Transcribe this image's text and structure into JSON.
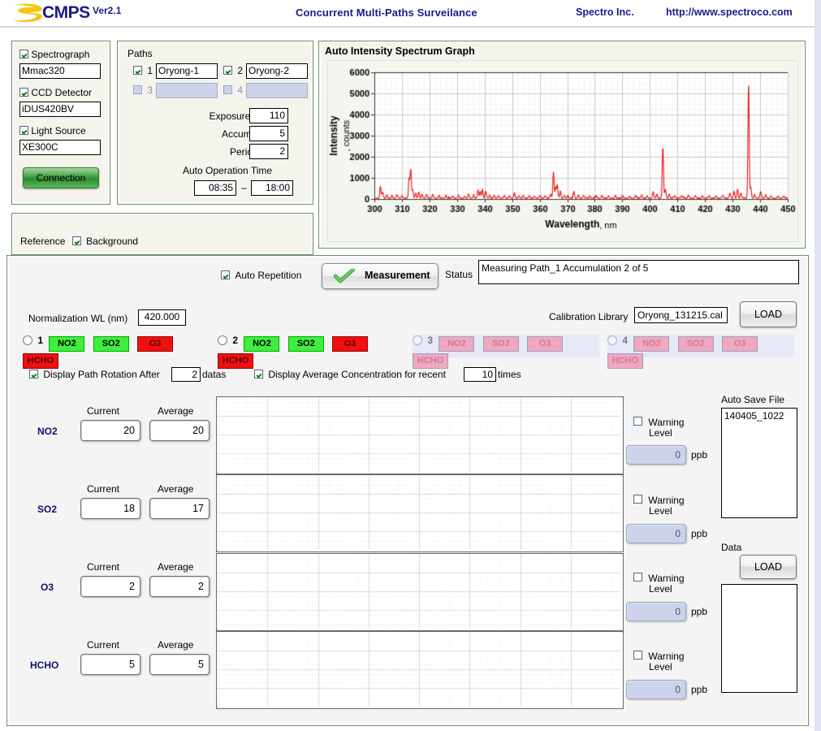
{
  "header": {
    "logo_text": "CMPS",
    "version": "Ver2.1",
    "title": "Concurrent Multi-Paths Surveilance",
    "company": "Spectro Inc.",
    "url": "http://www.spectroco.com"
  },
  "devices": {
    "spectrograph_label": "Spectrograph",
    "spectrograph_value": "Mmac320",
    "ccd_label": "CCD Detector",
    "ccd_value": "iDUS420BV",
    "light_label": "Light Source",
    "light_value": "XE300C",
    "connection_button": "Connection"
  },
  "paths": {
    "group_title": "Paths",
    "items": [
      {
        "num": "1",
        "name": "Oryong-1",
        "enabled": true
      },
      {
        "num": "2",
        "name": "Oryong-2",
        "enabled": true
      },
      {
        "num": "3",
        "name": "",
        "enabled": false
      },
      {
        "num": "4",
        "name": "",
        "enabled": false
      }
    ],
    "exposure_label": "Exposure(msec)",
    "exposure_value": "110",
    "accumulation_label": "Accumulation",
    "accumulation_value": "5",
    "period_label": "Period(Min)",
    "period_value": "2",
    "auto_time_label": "Auto Operation Time",
    "auto_time_start": "08:35",
    "auto_time_dash": "–",
    "auto_time_end": "18:00"
  },
  "reference": {
    "label": "Reference",
    "background_label": "Background",
    "background_checked": true
  },
  "measurement": {
    "auto_repetition_label": "Auto Repetition",
    "auto_repetition_checked": true,
    "button_label": "Measurement",
    "status_label": "Status",
    "status_text": "Measuring  Path_1  Accumulation 2 of 5"
  },
  "calibration": {
    "normalization_label": "Normalization WL (nm)",
    "normalization_value": "420.000",
    "library_label": "Calibration Library",
    "library_value": "Oryong_131215.cal",
    "load_button": "LOAD"
  },
  "path_status": [
    {
      "num": "1",
      "enabled": true,
      "gases": [
        {
          "name": "NO2",
          "state": "ok"
        },
        {
          "name": "SO2",
          "state": "ok"
        },
        {
          "name": "O3",
          "state": "alarm"
        },
        {
          "name": "HCHO",
          "state": "alarm"
        }
      ]
    },
    {
      "num": "2",
      "enabled": true,
      "gases": [
        {
          "name": "NO2",
          "state": "ok"
        },
        {
          "name": "SO2",
          "state": "ok"
        },
        {
          "name": "O3",
          "state": "alarm"
        },
        {
          "name": "HCHO",
          "state": "alarm"
        }
      ]
    },
    {
      "num": "3",
      "enabled": false,
      "gases": [
        {
          "name": "NO2",
          "state": "off"
        },
        {
          "name": "SO2",
          "state": "off"
        },
        {
          "name": "O3",
          "state": "off"
        },
        {
          "name": "HCHO",
          "state": "off"
        }
      ]
    },
    {
      "num": "4",
      "enabled": false,
      "gases": [
        {
          "name": "NO2",
          "state": "off"
        },
        {
          "name": "SO2",
          "state": "off"
        },
        {
          "name": "O3",
          "state": "off"
        },
        {
          "name": "HCHO",
          "state": "off"
        }
      ]
    }
  ],
  "display_options": {
    "rotation_checked": true,
    "rotation_label_pre": "Display Path Rotation After",
    "rotation_value": "2",
    "rotation_label_post": "datas",
    "average_checked": true,
    "average_label_pre": "Display Average Concentration for recent",
    "average_value": "10",
    "average_label_post": "times"
  },
  "gas_rows": [
    {
      "name": "NO2",
      "current_label": "Current",
      "average_label": "Average",
      "current": "20",
      "average": "20",
      "warning_label_1": "Warning",
      "warning_label_2": "Level",
      "warning_checked": false,
      "warning_value": "0",
      "unit": "ppb"
    },
    {
      "name": "SO2",
      "current_label": "Current",
      "average_label": "Average",
      "current": "18",
      "average": "17",
      "warning_label_1": "Warning",
      "warning_label_2": "Level",
      "warning_checked": false,
      "warning_value": "0",
      "unit": "ppb"
    },
    {
      "name": "O3",
      "current_label": "Current",
      "average_label": "Average",
      "current": "2",
      "average": "2",
      "warning_label_1": "Warning",
      "warning_label_2": "Level",
      "warning_checked": false,
      "warning_value": "0",
      "unit": "ppb"
    },
    {
      "name": "HCHO",
      "current_label": "Current",
      "average_label": "Average",
      "current": "5",
      "average": "5",
      "warning_label_1": "Warning",
      "warning_label_2": "Level",
      "warning_checked": false,
      "warning_value": "0",
      "unit": "ppb"
    }
  ],
  "auto_save": {
    "label": "Auto Save File",
    "file": "140405_1022"
  },
  "data_panel": {
    "label": "Data",
    "load_button": "LOAD",
    "items": ""
  },
  "colors": {
    "brand_navy": "#1a1a8c",
    "spectrum_red": "#ee1111",
    "chip_ok": "#3df03d",
    "chip_alarm": "#f01010",
    "chip_off": "#f0a8c0",
    "panel_border": "#6b8e6b"
  },
  "chart_data": {
    "type": "line",
    "title": "Auto Intensity Spectrum Graph",
    "xlabel": "Wavelength, nm",
    "ylabel": "Intensity, counts",
    "xlim": [
      300,
      450
    ],
    "ylim": [
      0,
      6000
    ],
    "xticks": [
      300,
      310,
      320,
      330,
      340,
      350,
      360,
      370,
      380,
      390,
      400,
      410,
      420,
      430,
      440,
      450
    ],
    "yticks": [
      0,
      1000,
      2000,
      3000,
      4000,
      5000,
      6000
    ],
    "grid": true,
    "legend": "none",
    "series": [
      {
        "name": "Intensity",
        "color": "#ee1111",
        "peaks": [
          [
            302.2,
            560
          ],
          [
            303.0,
            300
          ],
          [
            304.5,
            150
          ],
          [
            306.4,
            120
          ],
          [
            308.2,
            180
          ],
          [
            310.0,
            120
          ],
          [
            312.6,
            950
          ],
          [
            313.2,
            1390
          ],
          [
            313.9,
            420
          ],
          [
            315.0,
            240
          ],
          [
            316.1,
            300
          ],
          [
            317.3,
            180
          ],
          [
            319.0,
            150
          ],
          [
            321.2,
            180
          ],
          [
            323.5,
            120
          ],
          [
            326.0,
            140
          ],
          [
            328.4,
            110
          ],
          [
            330.5,
            130
          ],
          [
            332.8,
            100
          ],
          [
            334.2,
            200
          ],
          [
            336.0,
            130
          ],
          [
            337.6,
            380
          ],
          [
            338.4,
            300
          ],
          [
            339.2,
            430
          ],
          [
            340.4,
            330
          ],
          [
            341.8,
            150
          ],
          [
            343.5,
            130
          ],
          [
            345.0,
            120
          ],
          [
            347.2,
            140
          ],
          [
            349.0,
            110
          ],
          [
            350.8,
            250
          ],
          [
            352.4,
            130
          ],
          [
            354.0,
            120
          ],
          [
            356.2,
            140
          ],
          [
            358.0,
            110
          ],
          [
            360.1,
            150
          ],
          [
            362.0,
            120
          ],
          [
            364.0,
            200
          ],
          [
            365.0,
            1240
          ],
          [
            365.8,
            520
          ],
          [
            366.4,
            620
          ],
          [
            367.5,
            330
          ],
          [
            369.0,
            150
          ],
          [
            370.2,
            130
          ],
          [
            372.4,
            340
          ],
          [
            374.0,
            150
          ],
          [
            376.0,
            120
          ],
          [
            378.2,
            110
          ],
          [
            380.5,
            120
          ],
          [
            382.6,
            130
          ],
          [
            385.0,
            110
          ],
          [
            387.4,
            120
          ],
          [
            390.0,
            130
          ],
          [
            392.5,
            110
          ],
          [
            394.8,
            120
          ],
          [
            397.0,
            140
          ],
          [
            399.0,
            110
          ],
          [
            401.2,
            330
          ],
          [
            402.5,
            180
          ],
          [
            404.7,
            2450
          ],
          [
            405.6,
            420
          ],
          [
            407.0,
            180
          ],
          [
            409.0,
            130
          ],
          [
            411.5,
            120
          ],
          [
            414.0,
            150
          ],
          [
            416.5,
            110
          ],
          [
            419.0,
            120
          ],
          [
            421.5,
            130
          ],
          [
            424.0,
            110
          ],
          [
            426.5,
            120
          ],
          [
            429.0,
            230
          ],
          [
            430.5,
            330
          ],
          [
            431.8,
            420
          ],
          [
            433.0,
            250
          ],
          [
            435.8,
            5480
          ],
          [
            436.6,
            520
          ],
          [
            438.0,
            180
          ],
          [
            440.2,
            330
          ],
          [
            442.0,
            150
          ],
          [
            444.0,
            120
          ],
          [
            446.5,
            110
          ],
          [
            448.5,
            100
          ]
        ],
        "baseline": 40
      }
    ]
  },
  "trend_charts": {
    "type": "line",
    "note": "empty trend plots",
    "grid": true,
    "series": []
  }
}
